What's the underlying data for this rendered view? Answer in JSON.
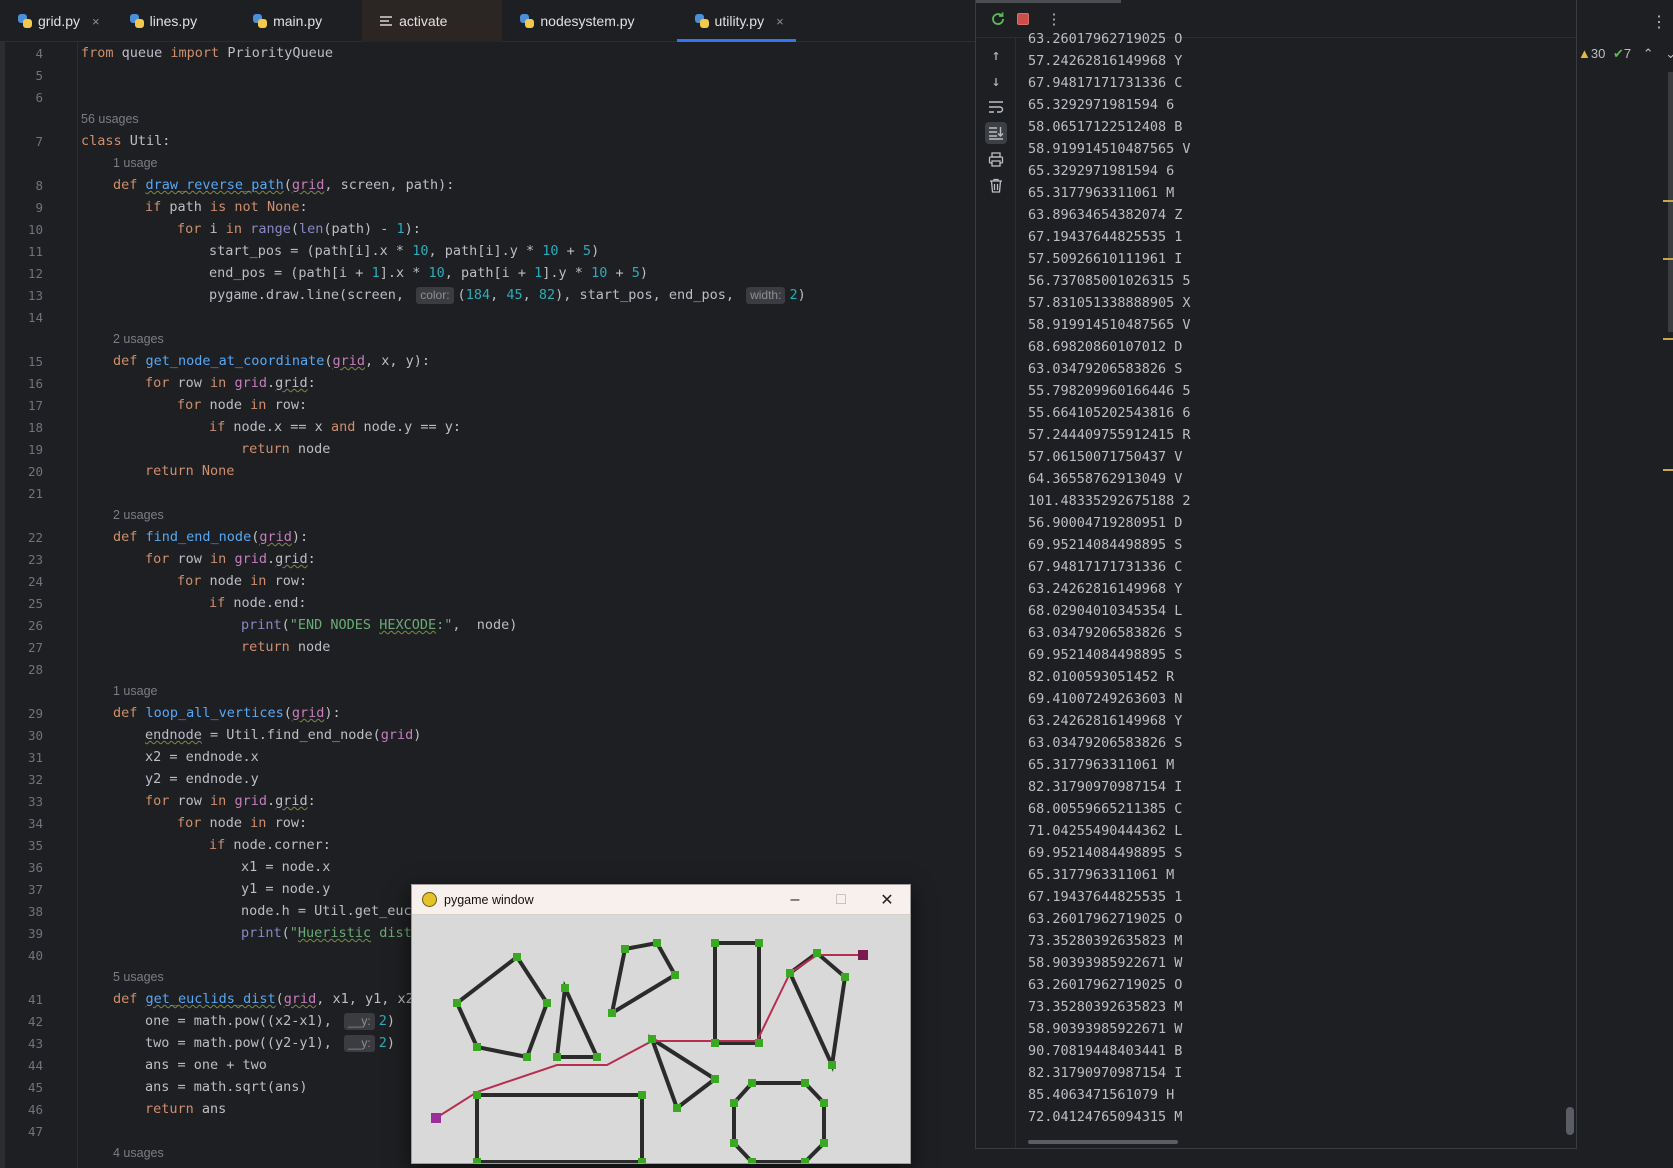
{
  "tabs": [
    {
      "label": "grid.py",
      "icon": "python-file-icon",
      "close": "×",
      "dark": false,
      "active": false
    },
    {
      "label": "lines.py",
      "icon": "python-file-icon",
      "close": "",
      "dark": false,
      "active": false
    },
    {
      "label": "main.py",
      "icon": "python-file-icon",
      "close": "",
      "dark": false,
      "active": false
    },
    {
      "label": "activate",
      "icon": "text-file-icon",
      "close": "",
      "dark": true,
      "active": false
    },
    {
      "label": "nodesystem.py",
      "icon": "python-file-icon",
      "close": "",
      "dark": false,
      "active": false
    },
    {
      "label": "utility.py",
      "icon": "python-file-icon",
      "close": "×",
      "dark": false,
      "active": true
    }
  ],
  "editor": {
    "line_numbers": [
      "4",
      "5",
      "6",
      "7",
      "8",
      "9",
      "10",
      "11",
      "12",
      "13",
      "14",
      "15",
      "16",
      "17",
      "18",
      "19",
      "20",
      "21",
      "22",
      "23",
      "24",
      "25",
      "26",
      "27",
      "28",
      "29",
      "30",
      "31",
      "32",
      "33",
      "34",
      "35",
      "36",
      "37",
      "38",
      "39",
      "40",
      "41",
      "42",
      "43",
      "44",
      "45",
      "46",
      "47"
    ],
    "usage_hints": [
      "56 usages",
      "1 usage",
      "2 usages",
      "2 usages",
      "1 usage",
      "5 usages",
      "4 usages"
    ],
    "inline_hints": {
      "color": "color:",
      "width": "width:",
      "y": "__y:"
    },
    "code": {
      "l4": "from queue import PriorityQueue",
      "l7": "class Util:",
      "l8": "def draw_reverse_path(grid, screen, path):",
      "l9": "if path is not None:",
      "l10": "for i in range(len(path) - 1):",
      "l11": "start_pos = (path[i].x * 10, path[i].y * 10 + 5)",
      "l12": "end_pos = (path[i + 1].x * 10, path[i + 1].y * 10 + 5)",
      "l13a": "pygame.draw.line(screen, ",
      "l13b": "(184, 45, 82), start_pos, end_pos, ",
      "l13c": "2)",
      "l15": "def get_node_at_coordinate(grid, x, y):",
      "l16": "for row in grid.grid:",
      "l17": "for node in row:",
      "l18": "if node.x == x and node.y == y:",
      "l19": "return node",
      "l20": "return None",
      "l22": "def find_end_node(grid):",
      "l23": "for row in grid.grid:",
      "l24": "for node in row:",
      "l25": "if node.end:",
      "l26": "print(\"END NODES HEXCODE:\",  node)",
      "l27": "return node",
      "l29": "def loop_all_vertices(grid):",
      "l30": "endnode = Util.find_end_node(grid)",
      "l31": "x2 = endnode.x",
      "l32": "y2 = endnode.y",
      "l33": "for row in grid.grid:",
      "l34": "for node in row:",
      "l35": "if node.corner:",
      "l36": "x1 = node.x",
      "l37": "y1 = node.y",
      "l38": "node.h = Util.get_euc",
      "l39": "print(\"Hueristic dist",
      "l41": "def get_euclids_dist(grid, x1, y1, x2",
      "l42a": "one = math.pow((x2-x1), ",
      "l42b": "2)",
      "l43a": "two = math.pow((y2-y1), ",
      "l43b": "2)",
      "l44": "ans = one + two",
      "l45": "ans = math.sqrt(ans)",
      "l46": "return ans"
    }
  },
  "run_panel": {
    "status_right": {
      "warnings": "30",
      "ok": "7"
    },
    "output_lines": [
      "63.26017962719025 O",
      "57.24262816149968 Y",
      "67.94817171731336 C",
      "65.3292971981594 6",
      "58.06517122512408 B",
      "58.91991451048756​5 V",
      "65.3292971981594 6",
      "65.3177963311061 M",
      "63.89634654382074 Z",
      "67.19437644825535 1",
      "57.50926610111961 I",
      "56.737085001026315 5",
      "57.831051338888905 X",
      "58.91991451048756​5 V",
      "68.69820860107012 D",
      "63.03479206583826 S",
      "55.798209960166446 5",
      "55.664105202543816 6",
      "57.244409755912415 R",
      "57.06150071750437 V",
      "64.36558762913049 V",
      "101.48335292675188 2",
      "56.90004719280951 D",
      "69.95214084498895 S",
      "67.94817171731336 C",
      "63.24262816149968 Y",
      "68.02904010345354 L",
      "63.03479206583826 S",
      "69.95214084498895 S",
      "82.0100593051452 R",
      "69.41007249263603 N",
      "63.24262816149968 Y",
      "63.03479206583826 S",
      "65.3177963311061 M",
      "82.31790970987154 I",
      "68.00559665211385 C",
      "71.04255490444362 L",
      "69.95214084498895 S",
      "65.3177963311061 M",
      "67.19437644825535 1",
      "63.26017962719025 O",
      "73.35280392635823 M",
      "58.90393985922671 W",
      "63.26017962719025 O",
      "73.35280392635823 M",
      "58.90393985922671 W",
      "90.70819448403441 B",
      "82.31790970987154 I",
      "85.4063471561079 H",
      "72.04124765094315 M"
    ]
  },
  "pygame_window": {
    "title": "pygame window",
    "minimize": "–",
    "maximize": "□",
    "close": "✕",
    "colors": {
      "background": "#d9d9d9",
      "obstacle": "#2b2b2b",
      "corner": "#3aa820",
      "path": "#b82d52",
      "start": "#9a2f9a",
      "end": "#7a1a4f"
    }
  }
}
